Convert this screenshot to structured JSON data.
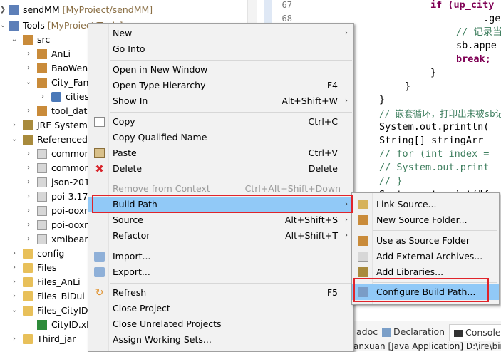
{
  "explorer": {
    "items": [
      {
        "label": "sendMM",
        "suffix": " [MyProiect/sendMM]",
        "icon": "project-icon"
      },
      {
        "label": "Tools",
        "suffix": " [MyProiect/Tools]",
        "icon": "project-icon"
      },
      {
        "label": "src",
        "icon": "source-folder-icon"
      },
      {
        "label": "AnLi",
        "icon": "package-icon"
      },
      {
        "label": "BaoWen_",
        "icon": "package-icon"
      },
      {
        "label": "City_FanX",
        "icon": "package-icon"
      },
      {
        "label": "cities_",
        "icon": "java-file-icon"
      },
      {
        "label": "tool_date",
        "icon": "package-icon"
      },
      {
        "label": "JRE System",
        "icon": "library-icon"
      },
      {
        "label": "Referenced",
        "icon": "library-icon"
      },
      {
        "label": "common",
        "icon": "jar-icon"
      },
      {
        "label": "common",
        "icon": "jar-icon"
      },
      {
        "label": "json-201",
        "icon": "jar-icon"
      },
      {
        "label": "poi-3.17.",
        "icon": "jar-icon"
      },
      {
        "label": "poi-ooxn",
        "icon": "jar-icon"
      },
      {
        "label": "poi-ooxn",
        "icon": "jar-icon"
      },
      {
        "label": "xmlbeans",
        "icon": "jar-icon"
      },
      {
        "label": "config",
        "icon": "folder-icon"
      },
      {
        "label": "Files",
        "icon": "folder-icon"
      },
      {
        "label": "Files_AnLi",
        "icon": "folder-icon"
      },
      {
        "label": "Files_BiDui",
        "icon": "folder-icon"
      },
      {
        "label": "Files_CityID",
        "icon": "folder-icon"
      },
      {
        "label": "CityID.xls",
        "icon": "excel-file-icon"
      },
      {
        "label": "Third_jar",
        "icon": "folder-icon"
      }
    ]
  },
  "editor": {
    "line_numbers": [
      "67",
      "68"
    ],
    "lines": [
      "if (up_city",
      ".ge",
      "// 记录当",
      "sb.appe",
      "break;",
      "}",
      "}",
      "}",
      "// 嵌套循环，打印出未被sb记",
      "System.out.println(",
      "String[] stringArr",
      "// for (int index =",
      "// System.out.print",
      "// }",
      "System.out.print(\"{"
    ]
  },
  "bottom_tabs": [
    {
      "label": "adoc"
    },
    {
      "label": "Declaration"
    },
    {
      "label": "Console"
    }
  ],
  "status_text": "anxuan [Java Application] D:\\ire\\bin\\",
  "context_menu": {
    "items": [
      {
        "label": "New",
        "shortcut": "",
        "submenu": true
      },
      {
        "label": "Go Into",
        "shortcut": ""
      },
      {
        "label": "Open in New Window",
        "shortcut": ""
      },
      {
        "label": "Open Type Hierarchy",
        "shortcut": "F4"
      },
      {
        "label": "Show In",
        "shortcut": "Alt+Shift+W",
        "submenu": true
      },
      {
        "label": "Copy",
        "shortcut": "Ctrl+C"
      },
      {
        "label": "Copy Qualified Name",
        "shortcut": ""
      },
      {
        "label": "Paste",
        "shortcut": "Ctrl+V"
      },
      {
        "label": "Delete",
        "shortcut": "Delete"
      },
      {
        "label": "Remove from Context",
        "shortcut": "Ctrl+Alt+Shift+Down",
        "disabled": true
      },
      {
        "label": "Build Path",
        "shortcut": "",
        "submenu": true,
        "highlighted": true
      },
      {
        "label": "Source",
        "shortcut": "Alt+Shift+S",
        "submenu": true
      },
      {
        "label": "Refactor",
        "shortcut": "Alt+Shift+T",
        "submenu": true
      },
      {
        "label": "Import...",
        "shortcut": ""
      },
      {
        "label": "Export...",
        "shortcut": ""
      },
      {
        "label": "Refresh",
        "shortcut": "F5"
      },
      {
        "label": "Close Project",
        "shortcut": ""
      },
      {
        "label": "Close Unrelated Projects",
        "shortcut": ""
      },
      {
        "label": "Assign Working Sets...",
        "shortcut": ""
      }
    ]
  },
  "build_path_menu": {
    "items": [
      {
        "label": "Link Source..."
      },
      {
        "label": "New Source Folder..."
      },
      {
        "label": "Use as Source Folder"
      },
      {
        "label": "Add External Archives..."
      },
      {
        "label": "Add Libraries..."
      },
      {
        "label": "Configure Build Path...",
        "highlighted": true
      }
    ]
  },
  "colors": {
    "highlight": "#91c9f7",
    "annotation_box": "#e0242b"
  }
}
